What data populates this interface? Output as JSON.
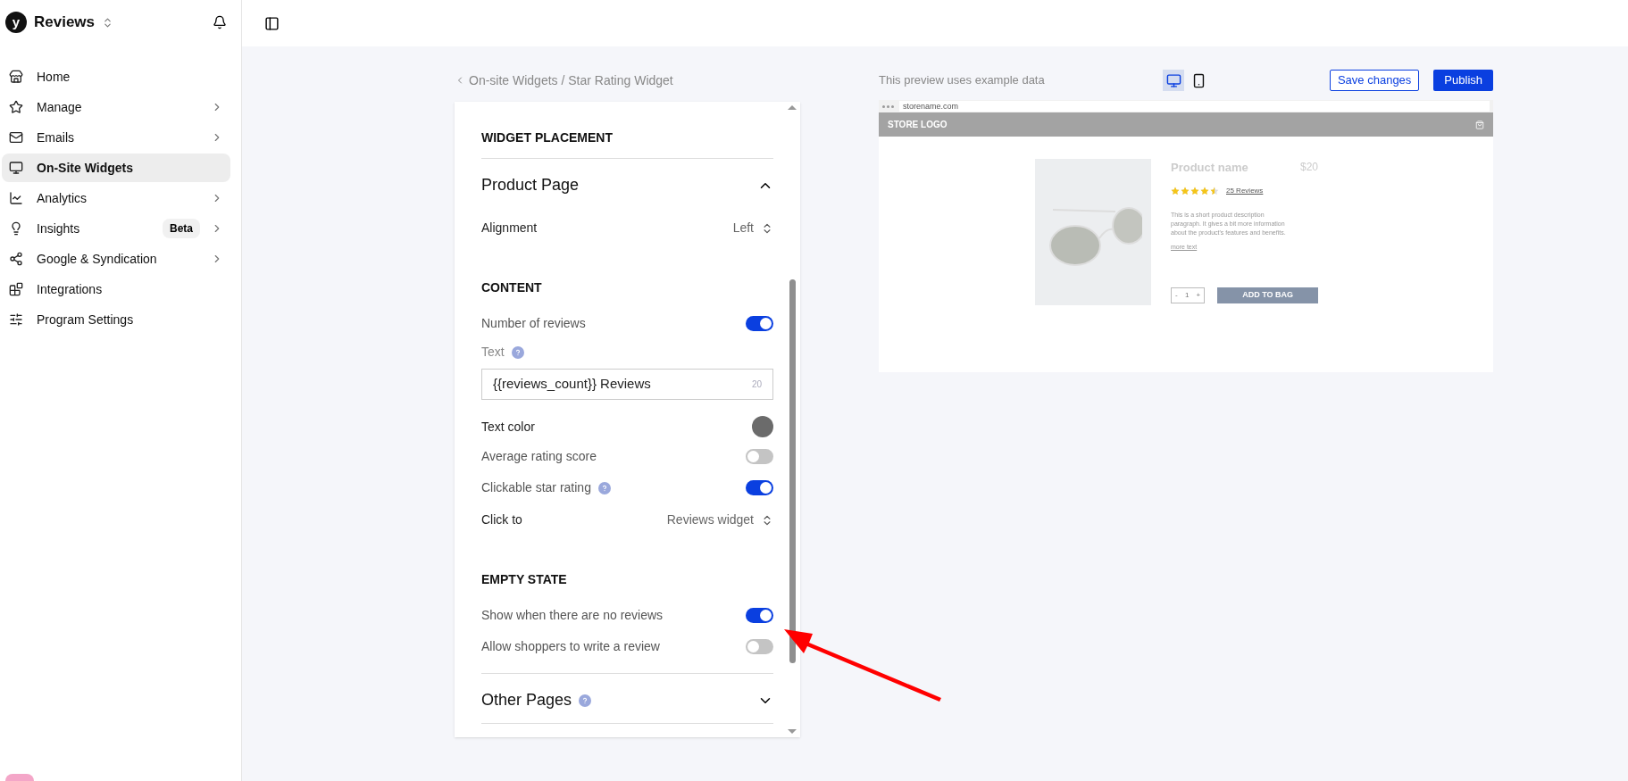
{
  "sidebar": {
    "brand": "Reviews",
    "logo_letter": "y",
    "items": [
      {
        "label": "Home",
        "selected": false,
        "submenu": false
      },
      {
        "label": "Manage",
        "selected": false,
        "submenu": true
      },
      {
        "label": "Emails",
        "selected": false,
        "submenu": true
      },
      {
        "label": "On-Site Widgets",
        "selected": true,
        "submenu": false
      },
      {
        "label": "Analytics",
        "selected": false,
        "submenu": true
      },
      {
        "label": "Insights",
        "selected": false,
        "submenu": true,
        "badge": "Beta"
      },
      {
        "label": "Google & Syndication",
        "selected": false,
        "submenu": true
      },
      {
        "label": "Integrations",
        "selected": false,
        "submenu": false
      },
      {
        "label": "Program Settings",
        "selected": false,
        "submenu": false
      }
    ]
  },
  "breadcrumb": "On-site Widgets / Star Rating Widget",
  "settings": [
    {
      "kind": "heading",
      "label": "WIDGET PLACEMENT"
    },
    {
      "kind": "section",
      "label": "Product Page",
      "expanded": true
    },
    {
      "kind": "select",
      "label": "Alignment",
      "value": "Left"
    },
    {
      "kind": "heading",
      "label": "CONTENT"
    },
    {
      "kind": "toggle",
      "label": "Number of reviews",
      "on": true
    },
    {
      "kind": "text_input",
      "label": "Text",
      "value": "{{reviews_count}} Reviews",
      "count": "20"
    },
    {
      "kind": "color",
      "label": "Text color",
      "color": "#6b6b6b"
    },
    {
      "kind": "toggle",
      "label": "Average rating score",
      "on": false
    },
    {
      "kind": "toggle",
      "label": "Clickable star rating",
      "on": true,
      "help": true
    },
    {
      "kind": "select",
      "label": "Click to",
      "value": "Reviews widget"
    },
    {
      "kind": "heading",
      "label": "EMPTY STATE"
    },
    {
      "kind": "toggle",
      "label": "Show when there are no reviews",
      "on": true
    },
    {
      "kind": "toggle",
      "label": "Allow shoppers to write a review",
      "on": false
    },
    {
      "kind": "section",
      "label": "Other Pages",
      "expanded": false,
      "help": true
    }
  ],
  "preview": {
    "note": "This preview uses example data",
    "devices": [
      {
        "kind": "desktop",
        "selected": true
      },
      {
        "kind": "mobile",
        "selected": false
      }
    ],
    "buttons": [
      {
        "label": "Save changes",
        "kind": "secondary"
      },
      {
        "label": "Publish",
        "kind": "primary"
      }
    ],
    "url": "storename.com",
    "store_logo": "STORE LOGO",
    "product_name": "Product name",
    "price": "$20",
    "stars": 4.5,
    "reviews_link": "25 Reviews",
    "description": "This is a short product description paragraph. It gives a bit more information about the product's features and benefits.",
    "more_link": "more text",
    "qty_minus": "-",
    "qty": "1",
    "qty_plus": "+",
    "add_button": "ADD TO BAG"
  }
}
